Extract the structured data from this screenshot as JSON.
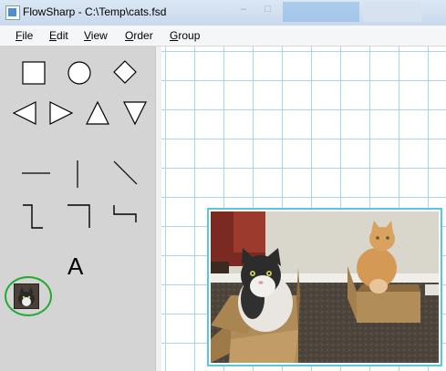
{
  "window": {
    "title": "FlowSharp - C:\\Temp\\cats.fsd",
    "ghost_min": "–",
    "ghost_max": "□"
  },
  "menu": {
    "items": [
      "File",
      "Edit",
      "View",
      "Order",
      "Group"
    ]
  },
  "toolbox": {
    "text_tool_label": "A",
    "tools": [
      "box",
      "circle",
      "diamond",
      "left-triangle",
      "right-triangle",
      "up-triangle",
      "down-triangle",
      "horizontal-line",
      "vertical-line",
      "diagonal-line",
      "dynamic-connector-1",
      "dynamic-connector-2",
      "dynamic-connector-3",
      "text",
      "image"
    ]
  },
  "canvas": {
    "grid": true,
    "selected_shape": "image",
    "selection_color": "#58c8dc"
  },
  "colors": {
    "highlight": "#22aa33",
    "grid": "#a9d6ec",
    "toolbox_bg": "#d4d4d4"
  }
}
